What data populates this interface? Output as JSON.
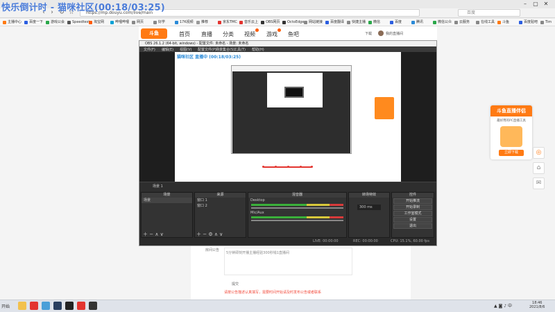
{
  "overlay_title": "快乐倒计时 - 猫咪社区(00:18/03:25)",
  "browser": {
    "url": "https://mp.douyu.com/live/main",
    "search_placeholder": "百度",
    "nav": [
      "‹",
      "›",
      "↻",
      "☆"
    ],
    "window_controls": [
      "–",
      "▢",
      "✕"
    ],
    "bookmarks": [
      {
        "label": "主播中心",
        "color": "#ff7a13"
      },
      {
        "label": "百度一下",
        "color": "#2b5ee0"
      },
      {
        "label": "游戏公会",
        "color": "#2aa84a"
      },
      {
        "label": "Speedtest",
        "color": "#555"
      },
      {
        "label": "淘宝网",
        "color": "#ff5b00"
      },
      {
        "label": "哔哩哔哩",
        "color": "#00a1d6"
      },
      {
        "label": "网页",
        "color": "#888"
      },
      {
        "label": "好学",
        "color": "#888"
      },
      {
        "label": "17K视频",
        "color": "#2a8ad8"
      },
      {
        "label": "推荐",
        "color": "#999"
      },
      {
        "label": "京东TMC",
        "color": "#e3342f"
      },
      {
        "label": "音乐云上",
        "color": "#e3342f"
      },
      {
        "label": "OBS网页",
        "color": "#333"
      },
      {
        "label": "OctoEdge",
        "color": "#333"
      },
      {
        "label": "网站链接",
        "color": "#888"
      },
      {
        "label": "百度翻译",
        "color": "#2b5ee0"
      },
      {
        "label": "快捷主播",
        "color": "#888"
      },
      {
        "label": "微信",
        "color": "#2aa84a"
      },
      {
        "label": "百度",
        "color": "#2b5ee0"
      },
      {
        "label": "腾讯",
        "color": "#2a8ad8"
      },
      {
        "label": "微信公众",
        "color": "#2aa84a"
      },
      {
        "label": "云服务",
        "color": "#888"
      },
      {
        "label": "在线工具",
        "color": "#888"
      },
      {
        "label": "斗鱼",
        "color": "#ff7a13"
      },
      {
        "label": "百度贴吧",
        "color": "#2b5ee0"
      },
      {
        "label": "Tim",
        "color": "#888"
      }
    ]
  },
  "site": {
    "logo": "斗鱼",
    "nav": [
      "首页",
      "直播",
      "分类",
      "视频",
      "游戏",
      "鱼吧"
    ],
    "download_label": "下载",
    "user_label": "我的直播间"
  },
  "obs": {
    "title": "OBS 26.1.2 (64-bit, windows) - 配置文件: 未命名 - 场景: 未命名",
    "menu": [
      "文件(F)",
      "编辑(E)",
      "视图(V)",
      "配置文件(P)",
      "场景集合(S)",
      "工具(T)",
      "帮助(H)"
    ],
    "preview_heading": "猫咪社区 直播中 (00:18/03:25)",
    "scene_name": "场景 1",
    "docks": {
      "scenes": {
        "title": "场景",
        "items": [
          "场景"
        ]
      },
      "sources": {
        "title": "来源",
        "items": [
          "窗口 1",
          "窗口 2"
        ]
      },
      "mixer": {
        "title": "混音器",
        "items": [
          "Desktop",
          "Mic/Aux"
        ]
      },
      "transitions": {
        "title": "转场特效",
        "duration": "300 ms"
      },
      "controls": {
        "title": "控件",
        "buttons": [
          "开始推流",
          "开始录制",
          "工作室模式",
          "设置",
          "退出"
        ]
      }
    },
    "status": {
      "live": "LIVE: 00:00:00",
      "rec": "REC: 00:00:00",
      "cpu": "CPU: 15.1%, 60.00 fps"
    }
  },
  "page": {
    "label": "房间公告",
    "content": "5分钟即刻开播主播经验300秒钱1直播间",
    "submit_label": "提交",
    "tip": "请按公告描述认真填写，需要时间开始请及时发布公告或者联系"
  },
  "promo": {
    "header": "斗鱼直播伴侣",
    "sub": "最好用的PC直播工具",
    "button": "立即下载"
  },
  "taskbar": {
    "start": "开始",
    "icons": [
      {
        "name": "file-explorer-icon",
        "color": "#f2c14e"
      },
      {
        "name": "chrome-icon",
        "color": "#e3342f"
      },
      {
        "name": "network-icon",
        "color": "#4a9fd8"
      },
      {
        "name": "steam-icon",
        "color": "#2a3f5f"
      },
      {
        "name": "obs-icon",
        "color": "#222"
      },
      {
        "name": "music-icon",
        "color": "#e3342f"
      },
      {
        "name": "game-icon",
        "color": "#333"
      }
    ],
    "time": "18:46",
    "date": "2021/8/6"
  }
}
